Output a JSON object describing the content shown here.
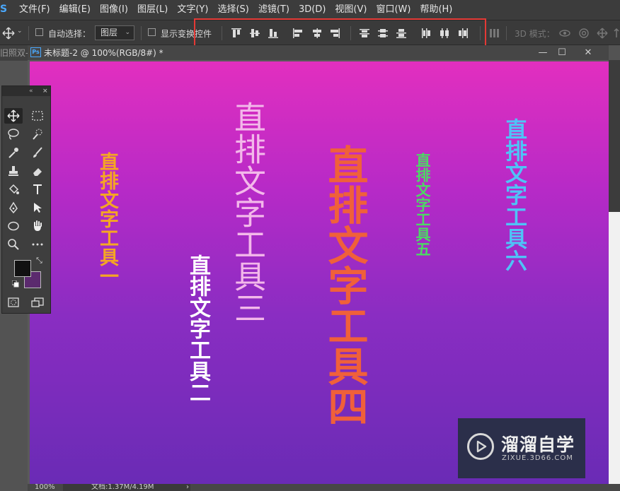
{
  "app": {
    "logo_letter": "S"
  },
  "menu": [
    "文件(F)",
    "编辑(E)",
    "图像(I)",
    "图层(L)",
    "文字(Y)",
    "选择(S)",
    "滤镜(T)",
    "3D(D)",
    "视图(V)",
    "窗口(W)",
    "帮助(H)"
  ],
  "options_bar": {
    "auto_select_label": "自动选择：",
    "auto_select_value": "图层",
    "show_transform_label": "显示变换控件",
    "mode_3d_label": "3D 模式："
  },
  "left_tab_label": "旧照双-",
  "document": {
    "title": "未标题-2 @ 100%(RGB/8#) *",
    "ps_badge": "Ps",
    "min_glyph": "—",
    "max_glyph": "☐",
    "close_glyph": "✕"
  },
  "status": {
    "zoom": "100%",
    "doc_info": "文档:1.37M/4.19M"
  },
  "texts": [
    {
      "content": "直排文字工具一",
      "color": "#f5a623"
    },
    {
      "content": "直排文字工具二",
      "color": "#ffffff"
    },
    {
      "content": "直排文字工具三",
      "color": "#f3b8ea"
    },
    {
      "content": "直排文字工具四",
      "color": "#f0603a"
    },
    {
      "content": "直排文字工具五",
      "color": "#4cd964"
    },
    {
      "content": "直排文字工具六",
      "color": "#4fc3f7"
    }
  ],
  "colors": {
    "foreground": "#111111",
    "background": "#5b2a6e",
    "highlight_box": "#e53935"
  },
  "watermark": {
    "title": "溜溜自学",
    "subtitle": "ZIXUE.3D66.COM"
  }
}
